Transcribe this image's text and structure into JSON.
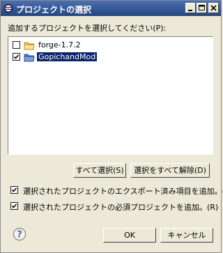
{
  "window": {
    "title": "プロジェクトの選択"
  },
  "dialog": {
    "prompt_label": "追加するプロジェクトを選択してください(P):",
    "projects": [
      {
        "name": "forge-1.7.2",
        "checked": false,
        "selected": false
      },
      {
        "name": "GopichandMod",
        "checked": true,
        "selected": true
      }
    ],
    "select_all_label": "すべて選択(S)",
    "deselect_all_label": "選択をすべて解除(D)",
    "options": [
      {
        "label": "選択されたプロジェクトのエクスポート済み項目を追加。(A)",
        "checked": true
      },
      {
        "label": "選択されたプロジェクトの必須プロジェクトを追加。(R)",
        "checked": true
      }
    ],
    "ok_label": "OK",
    "cancel_label": "キャンセル"
  }
}
